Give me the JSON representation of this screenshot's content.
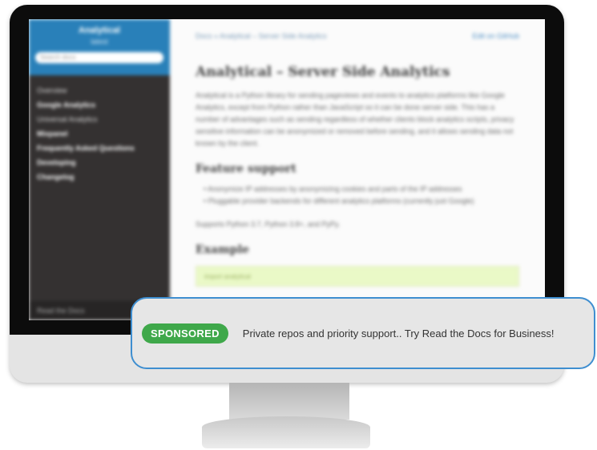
{
  "sidebar": {
    "project_title": "Analytical",
    "version": "latest",
    "search_placeholder": "Search docs",
    "items": [
      {
        "label": "Overview"
      },
      {
        "label": "Google Analytics"
      },
      {
        "label": "Universal Analytics"
      },
      {
        "label": "Mixpanel"
      },
      {
        "label": "Frequently Asked Questions"
      },
      {
        "label": "Developing"
      },
      {
        "label": "Changelog"
      }
    ],
    "footer": "Read the Docs"
  },
  "content": {
    "breadcrumb": "Docs » Analytical – Server Side Analytics",
    "edit_link": "Edit on GitHub",
    "title": "Analytical – Server Side Analytics",
    "intro": "Analytical is a Python library for sending pageviews and events to analytics platforms like Google Analytics, except from Python rather than JavaScript so it can be done server side. This has a number of advantages such as sending regardless of whether clients block analytics scripts, privacy sensitive information can be anonymized or removed before sending, and it allows sending data not known by the client.",
    "feature_heading": "Feature support",
    "features": [
      "Anonymize IP addresses by anonymizing cookies and parts of the IP addresses",
      "Pluggable provider backends for different analytics platforms (currently just Google)"
    ],
    "support_note": "Supports Python 3.7, Python 3.8+, and PyPy.",
    "example_heading": "Example",
    "code": "import analytical"
  },
  "ad": {
    "badge": "SPONSORED",
    "text": "Private repos and priority support.. Try Read the Docs for Business!"
  }
}
